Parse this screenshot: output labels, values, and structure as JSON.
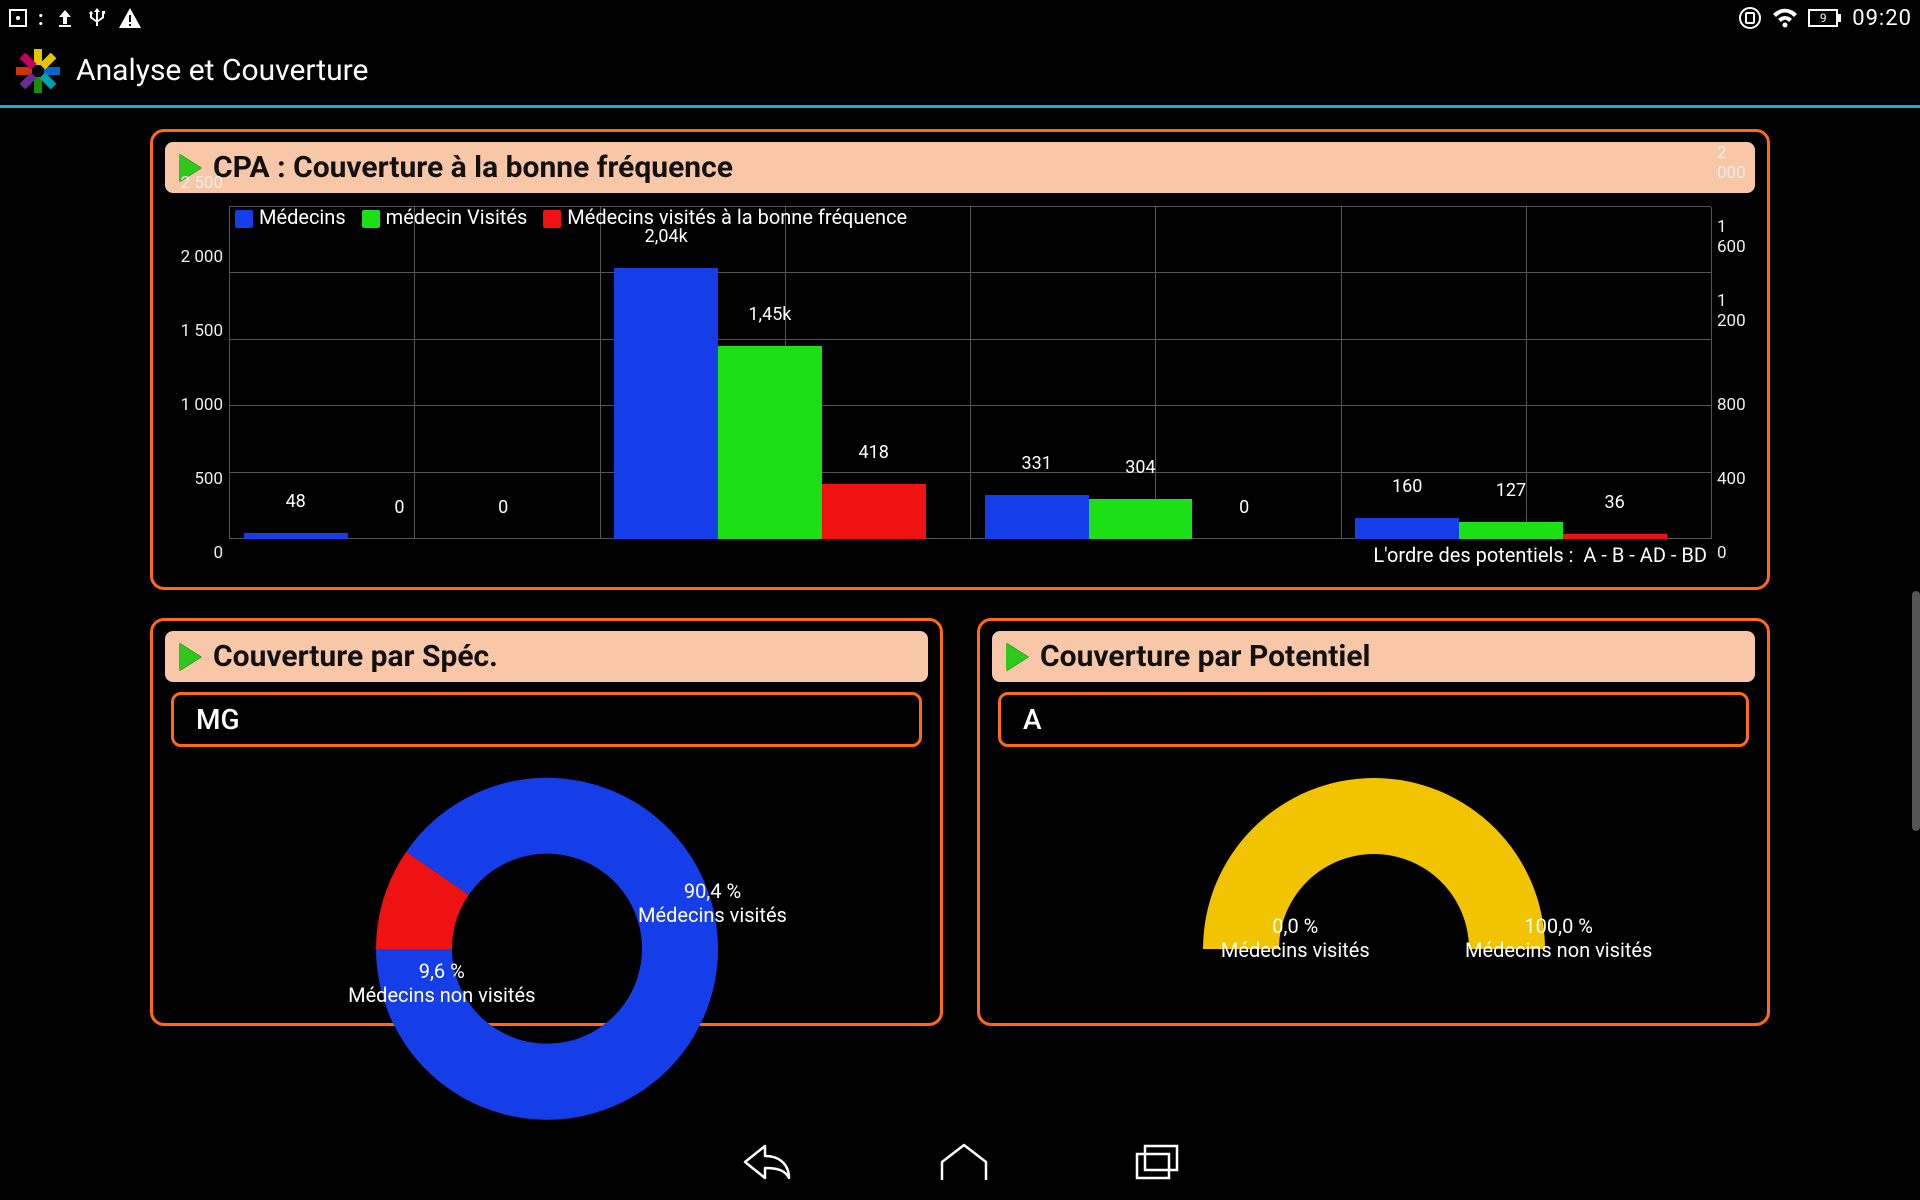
{
  "statusbar": {
    "clock": "09:20",
    "battery": "9"
  },
  "actionbar": {
    "title": "Analyse et Couverture"
  },
  "card_cpa": {
    "title": "CPA : Couverture à la bonne fréquence",
    "legend": {
      "s1": "Médecins",
      "s2": "médecin Visités",
      "s3": "Médecins visités à la bonne fréquence"
    },
    "footnote_label": "L'ordre des potentiels :",
    "footnote_order": "A - B - AD - BD",
    "labels": {
      "g1_b1": "48",
      "g1_b2": "0",
      "g1_b3": "0",
      "g2_b1": "2,04k",
      "g2_b2": "1,45k",
      "g2_b3": "418",
      "g3_b1": "331",
      "g3_b2": "304",
      "g3_b3": "0",
      "g4_b1": "160",
      "g4_b2": "127",
      "g4_b3": "36"
    },
    "yleft": {
      "t0": "0",
      "t1": "500",
      "t2": "1 000",
      "t3": "1 500",
      "t4": "2 000",
      "t5": "2 500"
    },
    "yright": {
      "t0": "0",
      "t1": "400",
      "t2": "800",
      "t3": "1 200",
      "t4": "1 600",
      "t5": "2 000"
    }
  },
  "card_spec": {
    "title": "Couverture par Spéc.",
    "sub": "MG",
    "pct_vis": "90,4 %",
    "lbl_vis": "Médecins visités",
    "pct_nvis": "9,6 %",
    "lbl_nvis": "Médecins non visités"
  },
  "card_pot": {
    "title": "Couverture par Potentiel",
    "sub": "A",
    "pct_vis": "0,0 %",
    "lbl_vis": "Médecins visités",
    "pct_nvis": "100,0 %",
    "lbl_nvis": "Médecins non visités"
  },
  "colors": {
    "blue": "#153ee8",
    "green": "#1ae015",
    "red": "#ef1212",
    "yellow": "#f2c300",
    "orange": "#ff6a13",
    "peach": "#f7c7a7",
    "teal": "#1fa7d4"
  },
  "chart_data": [
    {
      "type": "bar",
      "title": "CPA : Couverture à la bonne fréquence",
      "categories": [
        "A",
        "B",
        "AD",
        "BD"
      ],
      "category_order_note": "L'ordre des potentiels :  A - B - AD - BD",
      "series": [
        {
          "name": "Médecins",
          "color": "#153ee8",
          "values": [
            48,
            2040,
            331,
            160
          ]
        },
        {
          "name": "médecin Visités",
          "color": "#1ae015",
          "values": [
            0,
            1450,
            304,
            127
          ]
        },
        {
          "name": "Médecins visités à la bonne fréquence",
          "color": "#ef1212",
          "values": [
            0,
            418,
            0,
            36
          ]
        }
      ],
      "y_left": {
        "lim": [
          0,
          2500
        ],
        "ticks": [
          0,
          500,
          1000,
          1500,
          2000,
          2500
        ]
      },
      "y_right": {
        "lim": [
          0,
          2000
        ],
        "ticks": [
          0,
          400,
          800,
          1200,
          1600,
          2000
        ]
      },
      "grid": true
    },
    {
      "type": "pie",
      "title": "Couverture par Spéc.",
      "subset": "MG",
      "donut": true,
      "slices": [
        {
          "name": "Médecins visités",
          "value": 90.4,
          "color": "#153ee8"
        },
        {
          "name": "Médecins non visités",
          "value": 9.6,
          "color": "#ef1212"
        }
      ],
      "unit": "%"
    },
    {
      "type": "pie",
      "title": "Couverture par Potentiel",
      "subset": "A",
      "donut": true,
      "slices": [
        {
          "name": "Médecins visités",
          "value": 0.0,
          "color": "#153ee8"
        },
        {
          "name": "Médecins non visités",
          "value": 100.0,
          "color": "#f2c300"
        }
      ],
      "unit": "%"
    }
  ]
}
